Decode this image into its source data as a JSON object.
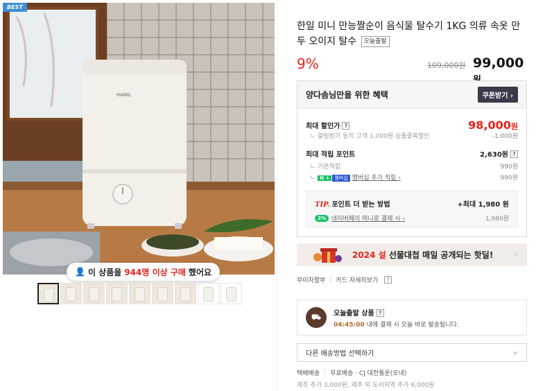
{
  "product": {
    "best_badge": "BEST",
    "title": "한일 미니 만능짤순이 음식물 탈수기 1KG 의류 속옷 만두 오이지 탈수",
    "delivery_tag": "오늘출발",
    "discount_rate": "9%",
    "original_price": "109,000원",
    "sale_price": "99,000",
    "price_unit": "원",
    "appliance_brand": "HANIL",
    "buy_count": {
      "prefix": "이 상품을",
      "count": "944명 이상 구매",
      "suffix": "했어요"
    }
  },
  "benefit": {
    "header": "양다솜님만을 위한 혜택",
    "coupon_button": "쿠폰받기 ›",
    "max_discount_label": "최대 할인가",
    "max_discount_price": "98,000",
    "price_unit": "원",
    "alarm_label": "알림받기 동의 고객 1,000원 상품중복할인",
    "alarm_value": "-1,000원",
    "max_points_label": "최대 적립 포인트",
    "max_points_value": "2,630원",
    "basic_label": "기본적립",
    "basic_value": "990원",
    "naver_badge": "N +",
    "member_badge": "멤버십",
    "member_label": "멤버십 추가 적립 ›",
    "member_value": "990원",
    "tip_label": "TIP.",
    "tip_title": "포인트 더 받는 방법",
    "tip_max": "+최대 1,980 원",
    "pay_badge": "2%",
    "pay_label": "네이버페이 머니로 결제 시 ›",
    "pay_value": "1,980원",
    "qmark": "?"
  },
  "promo": {
    "year": "2024 설",
    "text": "선물대첩 매일 공개되는 핫딜!",
    "arrow": "›"
  },
  "installment": {
    "label": "무이자할부",
    "card_label": "카드 자세히보기"
  },
  "today_delivery": {
    "title": "오늘출발 상품",
    "time": "04:45:00",
    "sub": "내에 결제 시 오늘 바로 발송됩니다."
  },
  "delivery_select": {
    "label": "다른 배송방법 선택하기",
    "chevron": "⌵"
  },
  "shipping": {
    "type": "택배배송",
    "detail": "무료배송 · CJ 대한통운(오네)",
    "extra": "제주 추가 3,000원, 제주 외 도서지역 추가 6,000원"
  },
  "thumbnails": [
    "thumb-1",
    "thumb-2",
    "thumb-3",
    "thumb-4",
    "thumb-5",
    "thumb-6",
    "thumb-7",
    "thumb-8",
    "thumb-9"
  ],
  "colors": {
    "accent_red": "#e5231c",
    "naver_green": "#19c265",
    "brown": "#5a3a2a"
  }
}
